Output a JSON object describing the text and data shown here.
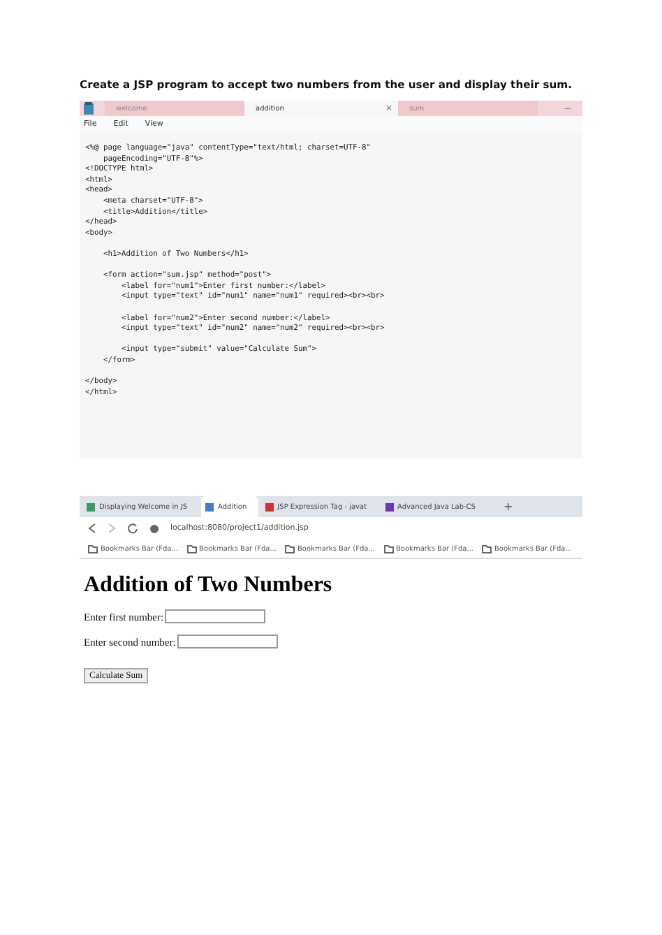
{
  "heading": "Create a JSP program to accept two numbers from the user and display their sum.",
  "editor": {
    "tabs": [
      {
        "label": "welcome",
        "selected": false
      },
      {
        "label": "addition",
        "selected": true,
        "close": "×"
      },
      {
        "label": "sum",
        "selected": false
      }
    ],
    "minimize": "—",
    "menu": [
      "File",
      "Edit",
      "View"
    ],
    "code": "<%@ page language=\"java\" contentType=\"text/html; charset=UTF-8\"\n    pageEncoding=\"UTF-8\"%>\n<!DOCTYPE html>\n<html>\n<head>\n    <meta charset=\"UTF-8\">\n    <title>Addition</title>\n</head>\n<body>\n\n    <h1>Addition of Two Numbers</h1>\n\n    <form action=\"sum.jsp\" method=\"post\">\n        <label for=\"num1\">Enter first number:</label>\n        <input type=\"text\" id=\"num1\" name=\"num1\" required><br><br>\n\n        <label for=\"num2\">Enter second number:</label>\n        <input type=\"text\" id=\"num2\" name=\"num2\" required><br><br>\n\n        <input type=\"submit\" value=\"Calculate Sum\">\n    </form>\n\n</body>\n</html>"
  },
  "browser": {
    "tabs": [
      {
        "label": "Displaying Welcome in JS",
        "selected": false
      },
      {
        "label": "Addition",
        "selected": true
      },
      {
        "label": "JSP Expression Tag - javat",
        "selected": false
      },
      {
        "label": "Advanced Java Lab-CS",
        "selected": false
      }
    ],
    "new_tab": "+",
    "url": "localhost:8080/project1/addition.jsp",
    "bookmarks": [
      "Bookmarks Bar (Fda...",
      "Bookmarks Bar (Fda...",
      "Bookmarks Bar (Fda...",
      "Bookmarks Bar (Fda...",
      "Bookmarks Bar (Fda..."
    ],
    "page": {
      "title": "Addition of Two Numbers",
      "fields": [
        {
          "label": "Enter first number:"
        },
        {
          "label": "Enter second number:"
        }
      ],
      "submit": "Calculate Sum"
    }
  }
}
